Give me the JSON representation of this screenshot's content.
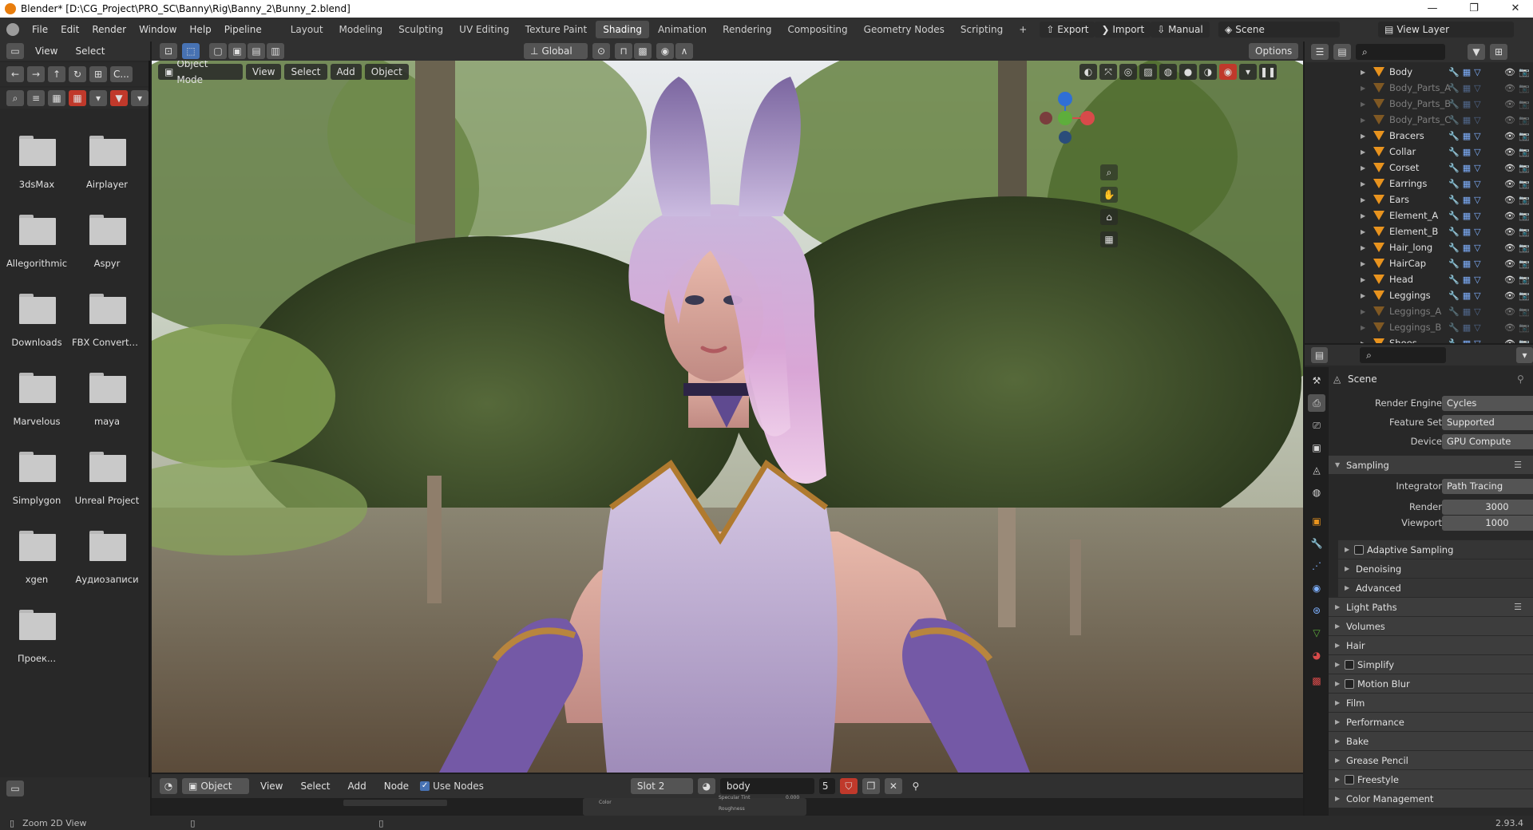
{
  "window": {
    "title": "Blender* [D:\\CG_Project\\PRO_SC\\Banny\\Rig\\Banny_2\\Bunny_2.blend]",
    "minimize": "—",
    "maximize": "❐",
    "close": "✕"
  },
  "menu": {
    "items": [
      "File",
      "Edit",
      "Render",
      "Window",
      "Help",
      "Pipeline"
    ]
  },
  "workspaces": {
    "tabs": [
      "Layout",
      "Modeling",
      "Sculpting",
      "UV Editing",
      "Texture Paint",
      "Shading",
      "Animation",
      "Rendering",
      "Compositing",
      "Geometry Nodes",
      "Scripting"
    ],
    "active_index": 5,
    "add_label": "+"
  },
  "addons": {
    "export_label": "Export",
    "import_label": "Import",
    "manual_label": "Manual"
  },
  "scene_selector": {
    "scene_label": "Scene",
    "view_layer_label": "View Layer"
  },
  "file_browser": {
    "header_view": "View",
    "header_select": "Select",
    "path_short": "C...",
    "folders": [
      "3dsMax",
      "Airplayer",
      "Allegorithmic",
      "Aspyr",
      "Downloads",
      "FBX Converte...",
      "Marvelous",
      "maya",
      "Simplygon",
      "Unreal Project",
      "xgen",
      "Аудиозаписи",
      "Проек..."
    ]
  },
  "viewport_header": {
    "orientation": "Global",
    "options_label": "Options",
    "mode": "Object Mode",
    "menus": [
      "View",
      "Select",
      "Add",
      "Object"
    ]
  },
  "node_header": {
    "object_label": "Object",
    "menus": [
      "View",
      "Select",
      "Add",
      "Node"
    ],
    "use_nodes_label": "Use Nodes",
    "slot": "Slot 2",
    "material": "body",
    "users": "5"
  },
  "node_peek": {
    "color_label": "Color",
    "specular_label": "Specular Tint",
    "specular_value": "0.000",
    "roughness_label": "Roughness"
  },
  "status": {
    "left_text": "Zoom 2D View",
    "version": "2.93.4"
  },
  "outliner": {
    "items": [
      {
        "name": "Body",
        "dim": false
      },
      {
        "name": "Body_Parts_A",
        "dim": true
      },
      {
        "name": "Body_Parts_B",
        "dim": true
      },
      {
        "name": "Body_Parts_C",
        "dim": true
      },
      {
        "name": "Bracers",
        "dim": false
      },
      {
        "name": "Collar",
        "dim": false
      },
      {
        "name": "Corset",
        "dim": false
      },
      {
        "name": "Earrings",
        "dim": false
      },
      {
        "name": "Ears",
        "dim": false
      },
      {
        "name": "Element_A",
        "dim": false
      },
      {
        "name": "Element_B",
        "dim": false
      },
      {
        "name": "Hair_long",
        "dim": false
      },
      {
        "name": "HairCap",
        "dim": false
      },
      {
        "name": "Head",
        "dim": false
      },
      {
        "name": "Leggings",
        "dim": false
      },
      {
        "name": "Leggings_A",
        "dim": true
      },
      {
        "name": "Leggings_B",
        "dim": true
      },
      {
        "name": "Shoes",
        "dim": false
      }
    ]
  },
  "properties": {
    "context": "Scene",
    "render_engine_label": "Render Engine",
    "render_engine": "Cycles",
    "feature_set_label": "Feature Set",
    "feature_set": "Supported",
    "device_label": "Device",
    "device": "GPU Compute",
    "sampling_label": "Sampling",
    "integrator_label": "Integrator",
    "integrator": "Path Tracing",
    "render_label": "Render",
    "render_samples": "3000",
    "viewport_label": "Viewport",
    "viewport_samples": "1000",
    "sub_adaptive": "Adaptive Sampling",
    "sub_denoising": "Denoising",
    "sub_advanced": "Advanced",
    "sections": [
      "Light Paths",
      "Volumes",
      "Hair",
      "Simplify",
      "Motion Blur",
      "Film",
      "Performance",
      "Bake",
      "Grease Pencil",
      "Freestyle",
      "Color Management"
    ]
  },
  "colors": {
    "accent": "#4772b3",
    "mesh_icon": "#e8931e",
    "active_tab": "#4d4d4d"
  }
}
